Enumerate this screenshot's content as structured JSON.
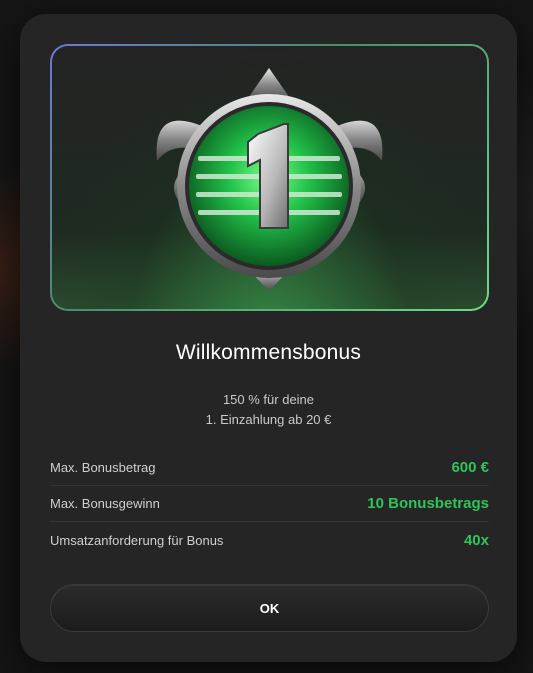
{
  "modal": {
    "title": "Willkommensbonus",
    "description_line1": "150 % für deine",
    "description_line2": "1. Einzahlung ab 20 €",
    "badge_number": "1",
    "rows": [
      {
        "label": "Max. Bonusbetrag",
        "value": "600 €"
      },
      {
        "label": "Max. Bonusgewinn",
        "value": "10 Bonusbetrags"
      },
      {
        "label": "Umsatzanforderung für Bonus",
        "value": "40x"
      }
    ],
    "ok_label": "OK"
  },
  "colors": {
    "accent_green": "#2ec45a",
    "modal_bg": "#252525",
    "page_bg": "#151515"
  }
}
